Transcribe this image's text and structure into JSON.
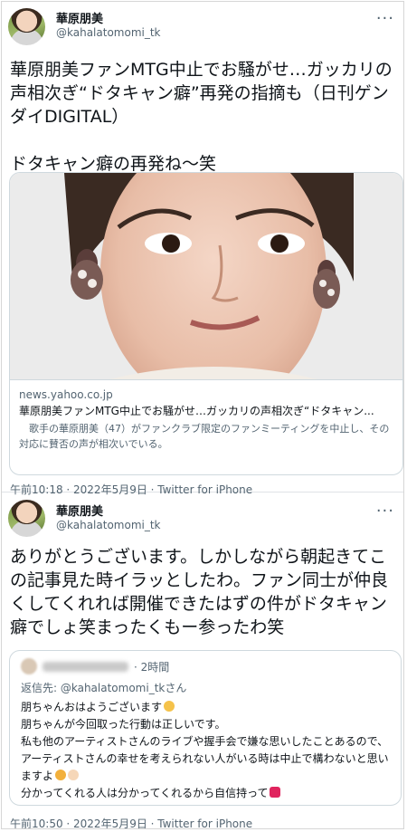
{
  "tweet1": {
    "name": "華原朋美",
    "handle": "@kahalatomomi_tk",
    "text": "華原朋美ファンMTG中止でお騒がせ…ガッカリの声相次ぎ“ドタキャン癖”再発の指摘も（日刊ゲンダイDIGITAL）\n\nドタキャン癖の再発ね〜笑",
    "card": {
      "domain": "news.yahoo.co.jp",
      "title": "華原朋美ファンMTG中止でお騒がせ…ガッカリの声相次ぎ“ドタキャン...",
      "description": "　歌手の華原朋美（47）がファンクラブ限定のファンミーティングを中止し、その対応に賛否の声が相次いでいる。"
    },
    "meta": "午前10:18 · 2022年5月9日 · Twitter for iPhone"
  },
  "tweet2": {
    "name": "華原朋美",
    "handle": "@kahalatomomi_tk",
    "text": "ありがとうございます。しかしながら朝起きてこの記事見た時イラッとしたわ。ファン同士が仲良くしてくれれば開催できたはずの件がドタキャン癖でしょ笑まったくもー参ったわ笑",
    "quote": {
      "time": "· 2時間",
      "reply_to": "返信先: @kahalatomomi_tkさん",
      "lines": [
        "朋ちゃんおはようございます",
        "朋ちゃんが今回取った行動は正しいです。",
        "私も他のアーティストさんのライブや握手会で嫌な思いしたことあるので、アーティストさんの幸せを考えられない人がいる時は中止で構わないと思いますよ",
        "分かってくれる人は分かってくれるから自信持って"
      ]
    },
    "meta": "午前10:50 · 2022年5月9日 · Twitter for iPhone"
  },
  "more_icon": "···",
  "colors": {
    "text": "#0f1419",
    "secondary": "#536471",
    "border": "#cfd9de",
    "heart": "#e0245e"
  }
}
